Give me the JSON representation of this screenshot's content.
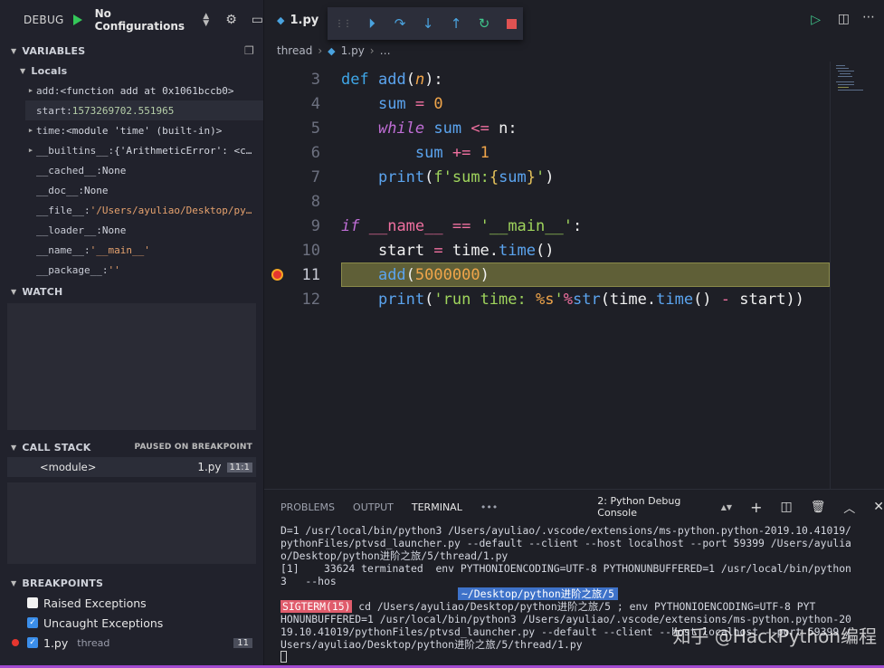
{
  "debug": {
    "label": "DEBUG",
    "config": "No Configurations"
  },
  "sections": {
    "variables": "VARIABLES",
    "locals": "Locals",
    "watch": "WATCH",
    "call_stack": "CALL STACK",
    "paused": "PAUSED ON BREAKPOINT",
    "breakpoints": "BREAKPOINTS"
  },
  "variables": [
    {
      "name": "add:",
      "value": "<function add at 0x1061bccb0>",
      "exp": true
    },
    {
      "name": "start:",
      "value": "1573269702.551965",
      "exp": false
    },
    {
      "name": "time:",
      "value": "<module 'time' (built-in)>",
      "exp": true
    },
    {
      "name": "__builtins__:",
      "value": "{'ArithmeticError': <c…",
      "exp": true
    },
    {
      "name": "__cached__:",
      "value": "None",
      "exp": false
    },
    {
      "name": "__doc__:",
      "value": "None",
      "exp": false
    },
    {
      "name": "__file__:",
      "value": "'/Users/ayuliao/Desktop/py…",
      "exp": false
    },
    {
      "name": "__loader__:",
      "value": "None",
      "exp": false
    },
    {
      "name": "__name__:",
      "value": "'__main__'",
      "exp": false
    },
    {
      "name": "__package__:",
      "value": "''",
      "exp": false
    },
    {
      "name": "__spec__:",
      "value": "None",
      "exp": false
    }
  ],
  "callstack": {
    "frame": "<module>",
    "file": "1.py",
    "pos": "11:1"
  },
  "breakpoints": [
    {
      "label": "Raised Exceptions",
      "checked": false
    },
    {
      "label": "Uncaught Exceptions",
      "checked": true
    },
    {
      "label": "1.py",
      "detail": "thread",
      "line": "11",
      "checked": true
    }
  ],
  "editor": {
    "tab": "1.py",
    "crumb1": "thread",
    "crumb2": "1.py",
    "crumb3": "…"
  },
  "line_numbers": [
    "3",
    "4",
    "5",
    "6",
    "7",
    "8",
    "9",
    "10",
    "11",
    "12"
  ],
  "panel": {
    "problems": "PROBLEMS",
    "output": "OUTPUT",
    "terminal": "TERMINAL",
    "more": "•••",
    "console": "2: Python Debug Console"
  },
  "terminal": [
    "D=1 /usr/local/bin/python3 /Users/ayuliao/.vscode/extensions/ms-python.python-2019.10.41019/",
    "pythonFiles/ptvsd_launcher.py --default --client --host localhost --port 59399 /Users/ayulia",
    "o/Desktop/python进阶之旅/5/thread/1.py",
    "[1]    33624 terminated  env PYTHONIOENCODING=UTF-8 PYTHONUNBUFFERED=1 /usr/local/bin/python",
    "3   --hos"
  ],
  "cwd": "~/Desktop/python进阶之旅/5",
  "signal": "SIGTERM(15)",
  "terminal2": [
    " cd /Users/ayuliao/Desktop/python进阶之旅/5 ; env PYTHONIOENCODING=UTF-8 PYT",
    "HONUNBUFFERED=1 /usr/local/bin/python3 /Users/ayuliao/.vscode/extensions/ms-python.python-20",
    "19.10.41019/pythonFiles/ptvsd_launcher.py --default --client --host localhost --port 59399 /",
    "Users/ayuliao/Desktop/python进阶之旅/5/thread/1.py"
  ],
  "watermark": "知乎 @HackPython编程"
}
